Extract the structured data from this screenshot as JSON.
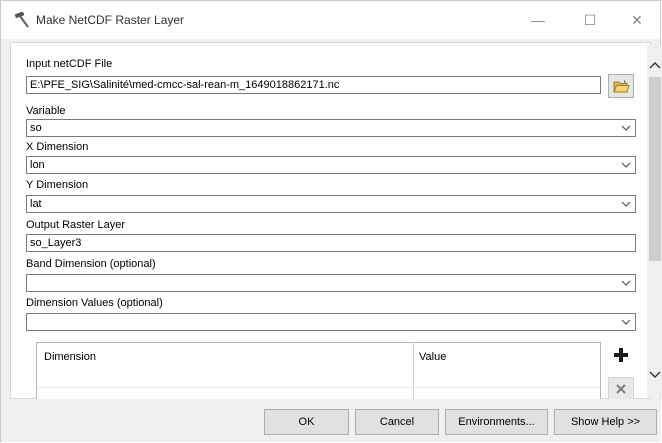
{
  "window": {
    "title": "Make NetCDF Raster Layer",
    "minimize_glyph": "—",
    "maximize_glyph": "☐",
    "close_glyph": "✕"
  },
  "form": {
    "input_netcdf_file": {
      "label": "Input netCDF File",
      "value": "E:\\PFE_SIG\\Salinité\\med-cmcc-sal-rean-m_1649018862171.nc"
    },
    "variable": {
      "label": "Variable",
      "value": "so"
    },
    "x_dimension": {
      "label": "X Dimension",
      "value": "lon"
    },
    "y_dimension": {
      "label": "Y Dimension",
      "value": "lat"
    },
    "output_raster_layer": {
      "label": "Output Raster Layer",
      "value": "so_Layer3"
    },
    "band_dimension": {
      "label": "Band Dimension (optional)",
      "value": ""
    },
    "dimension_values": {
      "label": "Dimension Values (optional)",
      "value": ""
    }
  },
  "table": {
    "columns": [
      "Dimension",
      "Value"
    ]
  },
  "buttons": {
    "ok": "OK",
    "cancel": "Cancel",
    "environments": "Environments...",
    "show_help": "Show Help >>"
  },
  "icons": {
    "app": "hammer-icon",
    "browse": "open-folder-icon",
    "add": "plus-icon",
    "remove": "x-icon"
  },
  "colors": {
    "add_icon": "#1a1a1a",
    "remove_icon": "#7f7f7f",
    "folder_yellow": "#e8b33a"
  }
}
